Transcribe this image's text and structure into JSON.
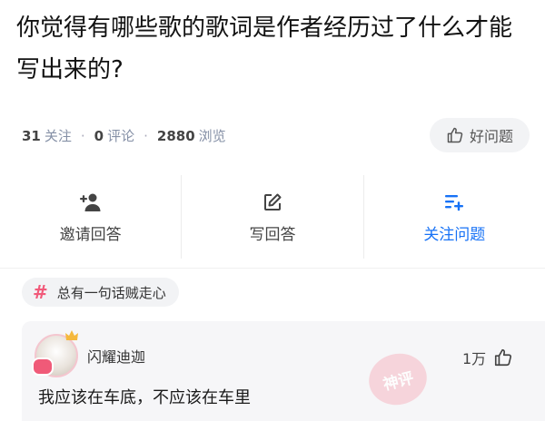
{
  "question": {
    "title": "你觉得有哪些歌的歌词是作者经历过了什么才能写出来的?"
  },
  "stats": {
    "followers": "31",
    "followers_label": "关注",
    "comments": "0",
    "comments_label": "评论",
    "views": "2880",
    "views_label": "浏览"
  },
  "good_button": {
    "label": "好问题",
    "icon": "thumbs-up-icon"
  },
  "actions": [
    {
      "label": "邀请回答",
      "icon": "add-user-icon"
    },
    {
      "label": "写回答",
      "icon": "edit-icon"
    },
    {
      "label": "关注问题",
      "icon": "follow-list-icon"
    }
  ],
  "topic": {
    "label": "总有一句话贼走心",
    "icon": "hash-icon"
  },
  "answer": {
    "author": "闪耀迪迦",
    "likes": "1万",
    "stamp": "神评",
    "text": "我应该在车底，不应该在车里"
  },
  "colors": {
    "accent": "#1772f6",
    "tag_hash": "#f15a7a",
    "stamp": "#f6cfd6"
  }
}
